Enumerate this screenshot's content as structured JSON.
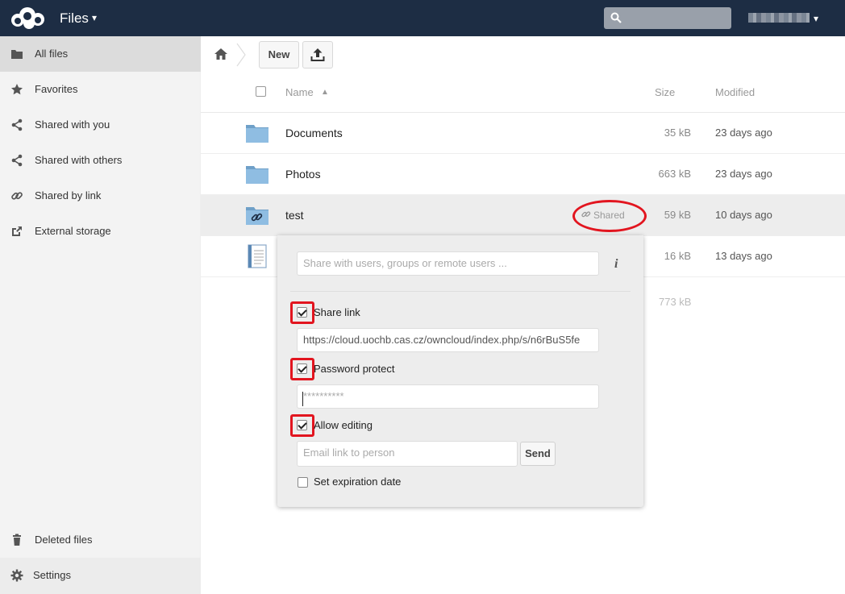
{
  "header": {
    "app_title": "Files",
    "app_caret": "▾",
    "user_caret": "▾"
  },
  "sidebar": {
    "items": [
      {
        "label": "All files",
        "icon": "folder-icon",
        "active": true
      },
      {
        "label": "Favorites",
        "icon": "star-icon"
      },
      {
        "label": "Shared with you",
        "icon": "share-icon"
      },
      {
        "label": "Shared with others",
        "icon": "share-icon"
      },
      {
        "label": "Shared by link",
        "icon": "link-icon"
      },
      {
        "label": "External storage",
        "icon": "external-icon"
      }
    ],
    "deleted_label": "Deleted files",
    "settings_label": "Settings"
  },
  "controls": {
    "new_label": "New"
  },
  "table": {
    "columns": {
      "name": "Name",
      "sort_arrow": "▲",
      "size": "Size",
      "modified": "Modified"
    },
    "rows": [
      {
        "name": "Documents",
        "size": "35 kB",
        "modified": "23 days ago",
        "type": "folder"
      },
      {
        "name": "Photos",
        "size": "663 kB",
        "modified": "23 days ago",
        "type": "folder"
      },
      {
        "name": "test",
        "size": "59 kB",
        "modified": "10 days ago",
        "type": "shared-folder",
        "shared_label": "Shared"
      },
      {
        "name": "",
        "size": "16 kB",
        "modified": "13 days ago",
        "type": "document"
      }
    ],
    "summary_size": "773 kB"
  },
  "share": {
    "search_placeholder": "Share with users, groups or remote users ...",
    "info_glyph": "i",
    "share_link_label": "Share link",
    "share_link_checked": true,
    "link_url": "https://cloud.uochb.cas.cz/owncloud/index.php/s/n6rBuS5fe",
    "password_label": "Password protect",
    "password_checked": true,
    "password_value": "**********",
    "allow_editing_label": "Allow editing",
    "allow_editing_checked": true,
    "email_placeholder": "Email link to person",
    "send_label": "Send",
    "expiration_label": "Set expiration date",
    "expiration_checked": false
  },
  "colors": {
    "header_bg": "#1d2d44",
    "highlight_red": "#e2151f",
    "folder_blue": "#7fb0d9"
  }
}
